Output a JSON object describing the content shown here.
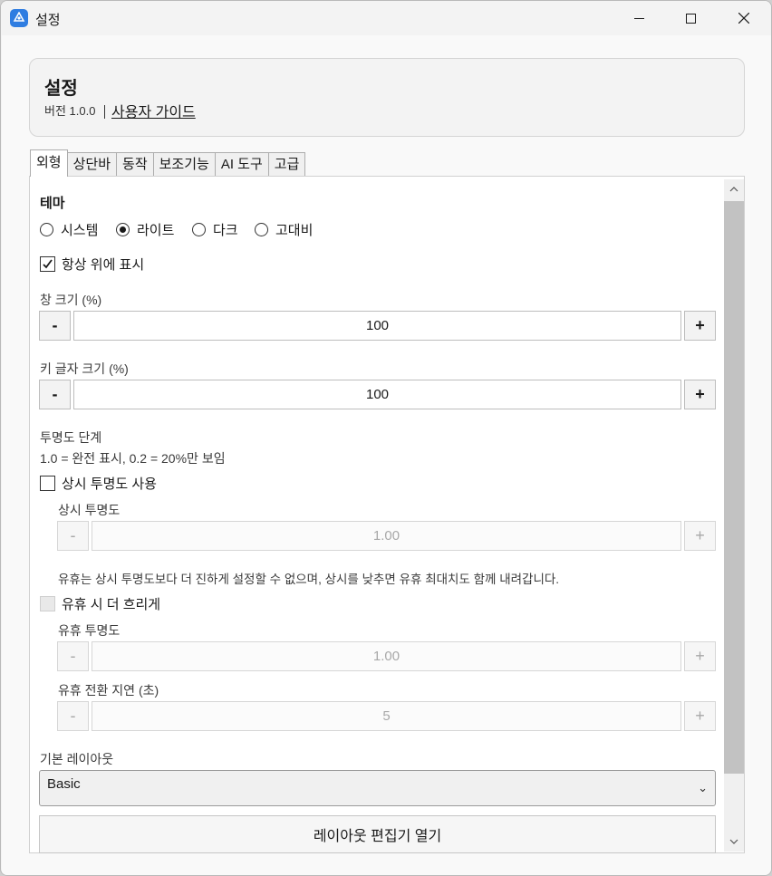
{
  "window": {
    "title": "설정",
    "app_icon": "app-logo-icon",
    "controls": [
      "minimize-icon",
      "maximize-icon",
      "close-icon"
    ]
  },
  "header": {
    "title": "설정",
    "version": "버전 1.0.0",
    "guide_link": "사용자 가이드"
  },
  "tabs": [
    {
      "label": "외형",
      "active": true
    },
    {
      "label": "상단바",
      "active": false
    },
    {
      "label": "동작",
      "active": false
    },
    {
      "label": "보조기능",
      "active": false
    },
    {
      "label": "AI 도구",
      "active": false
    },
    {
      "label": "고급",
      "active": false
    }
  ],
  "theme": {
    "heading": "테마",
    "options": [
      "시스템",
      "라이트",
      "다크",
      "고대비"
    ],
    "selected": "라이트"
  },
  "always_on_top": {
    "label": "항상 위에 표시",
    "checked": true
  },
  "window_size": {
    "label": "창 크기 (%)",
    "value": "100",
    "minus": "-",
    "plus": "+"
  },
  "key_font_size": {
    "label": "키 글자 크기 (%)",
    "value": "100",
    "minus": "-",
    "plus": "+"
  },
  "opacity": {
    "heading": "투명도 단계",
    "hint": "1.0 = 완전 표시, 0.2 = 20%만 보임",
    "use_constant": {
      "label": "상시 투명도 사용",
      "checked": false
    },
    "constant_label": "상시 투명도",
    "constant_value": "1.00",
    "note": "유휴는 상시 투명도보다 더 진하게 설정할 수 없으며, 상시를 낮추면 유휴 최대치도 함께 내려갑니다.",
    "idle_dim": {
      "label": "유휴 시 더 흐리게",
      "checked": false
    },
    "idle_opacity_label": "유휴 투명도",
    "idle_opacity_value": "1.00",
    "idle_delay_label": "유휴 전환 지연 (초)",
    "idle_delay_value": "5",
    "minus": "-",
    "plus": "+"
  },
  "layout": {
    "label": "기본 레이아웃",
    "selected": "Basic",
    "open_editor": "레이아웃 편집기 열기"
  }
}
